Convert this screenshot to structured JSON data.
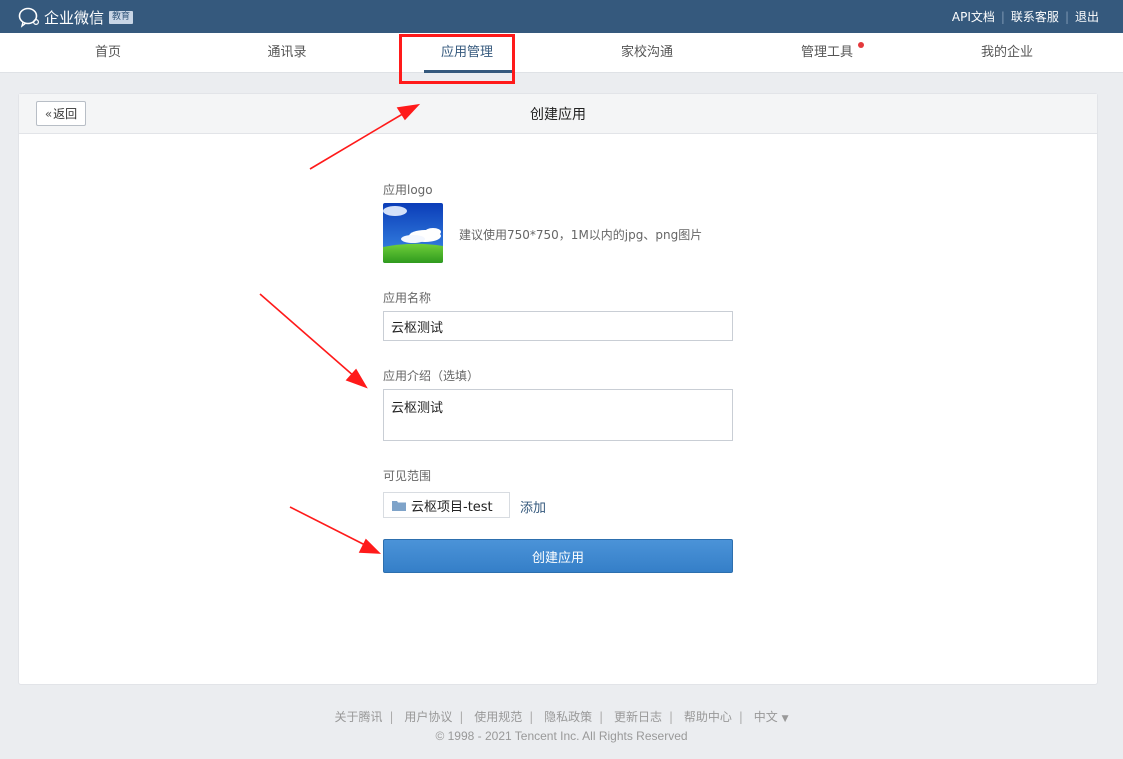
{
  "topbar": {
    "brand_name": "企业微信",
    "brand_badge": "教育",
    "links": [
      "API文档",
      "联系客服",
      "退出"
    ]
  },
  "nav": {
    "items": [
      "首页",
      "通讯录",
      "应用管理",
      "家校沟通",
      "管理工具",
      "我的企业"
    ],
    "active_index": 2
  },
  "page": {
    "back_label": "返回",
    "title": "创建应用",
    "logo_label": "应用logo",
    "logo_hint": "建议使用750*750，1M以内的jpg、png图片",
    "name_label": "应用名称",
    "name_value": "云枢测试",
    "intro_label": "应用介绍（选填）",
    "intro_value": "云枢测试",
    "scope_label": "可见范围",
    "scope_item": "云枢项目-test",
    "add_label": "添加",
    "submit_label": "创建应用"
  },
  "footer": {
    "links": [
      "关于腾讯",
      "用户协议",
      "使用规范",
      "隐私政策",
      "更新日志",
      "帮助中心"
    ],
    "language": "中文",
    "copyright": "© 1998 - 2021 Tencent Inc. All Rights Reserved"
  },
  "colors": {
    "topbar": "#35597d",
    "accent": "#35597d",
    "primary_button": "#3c87cf",
    "annotation": "#ff1a1a",
    "notification_dot": "#e4393c"
  }
}
